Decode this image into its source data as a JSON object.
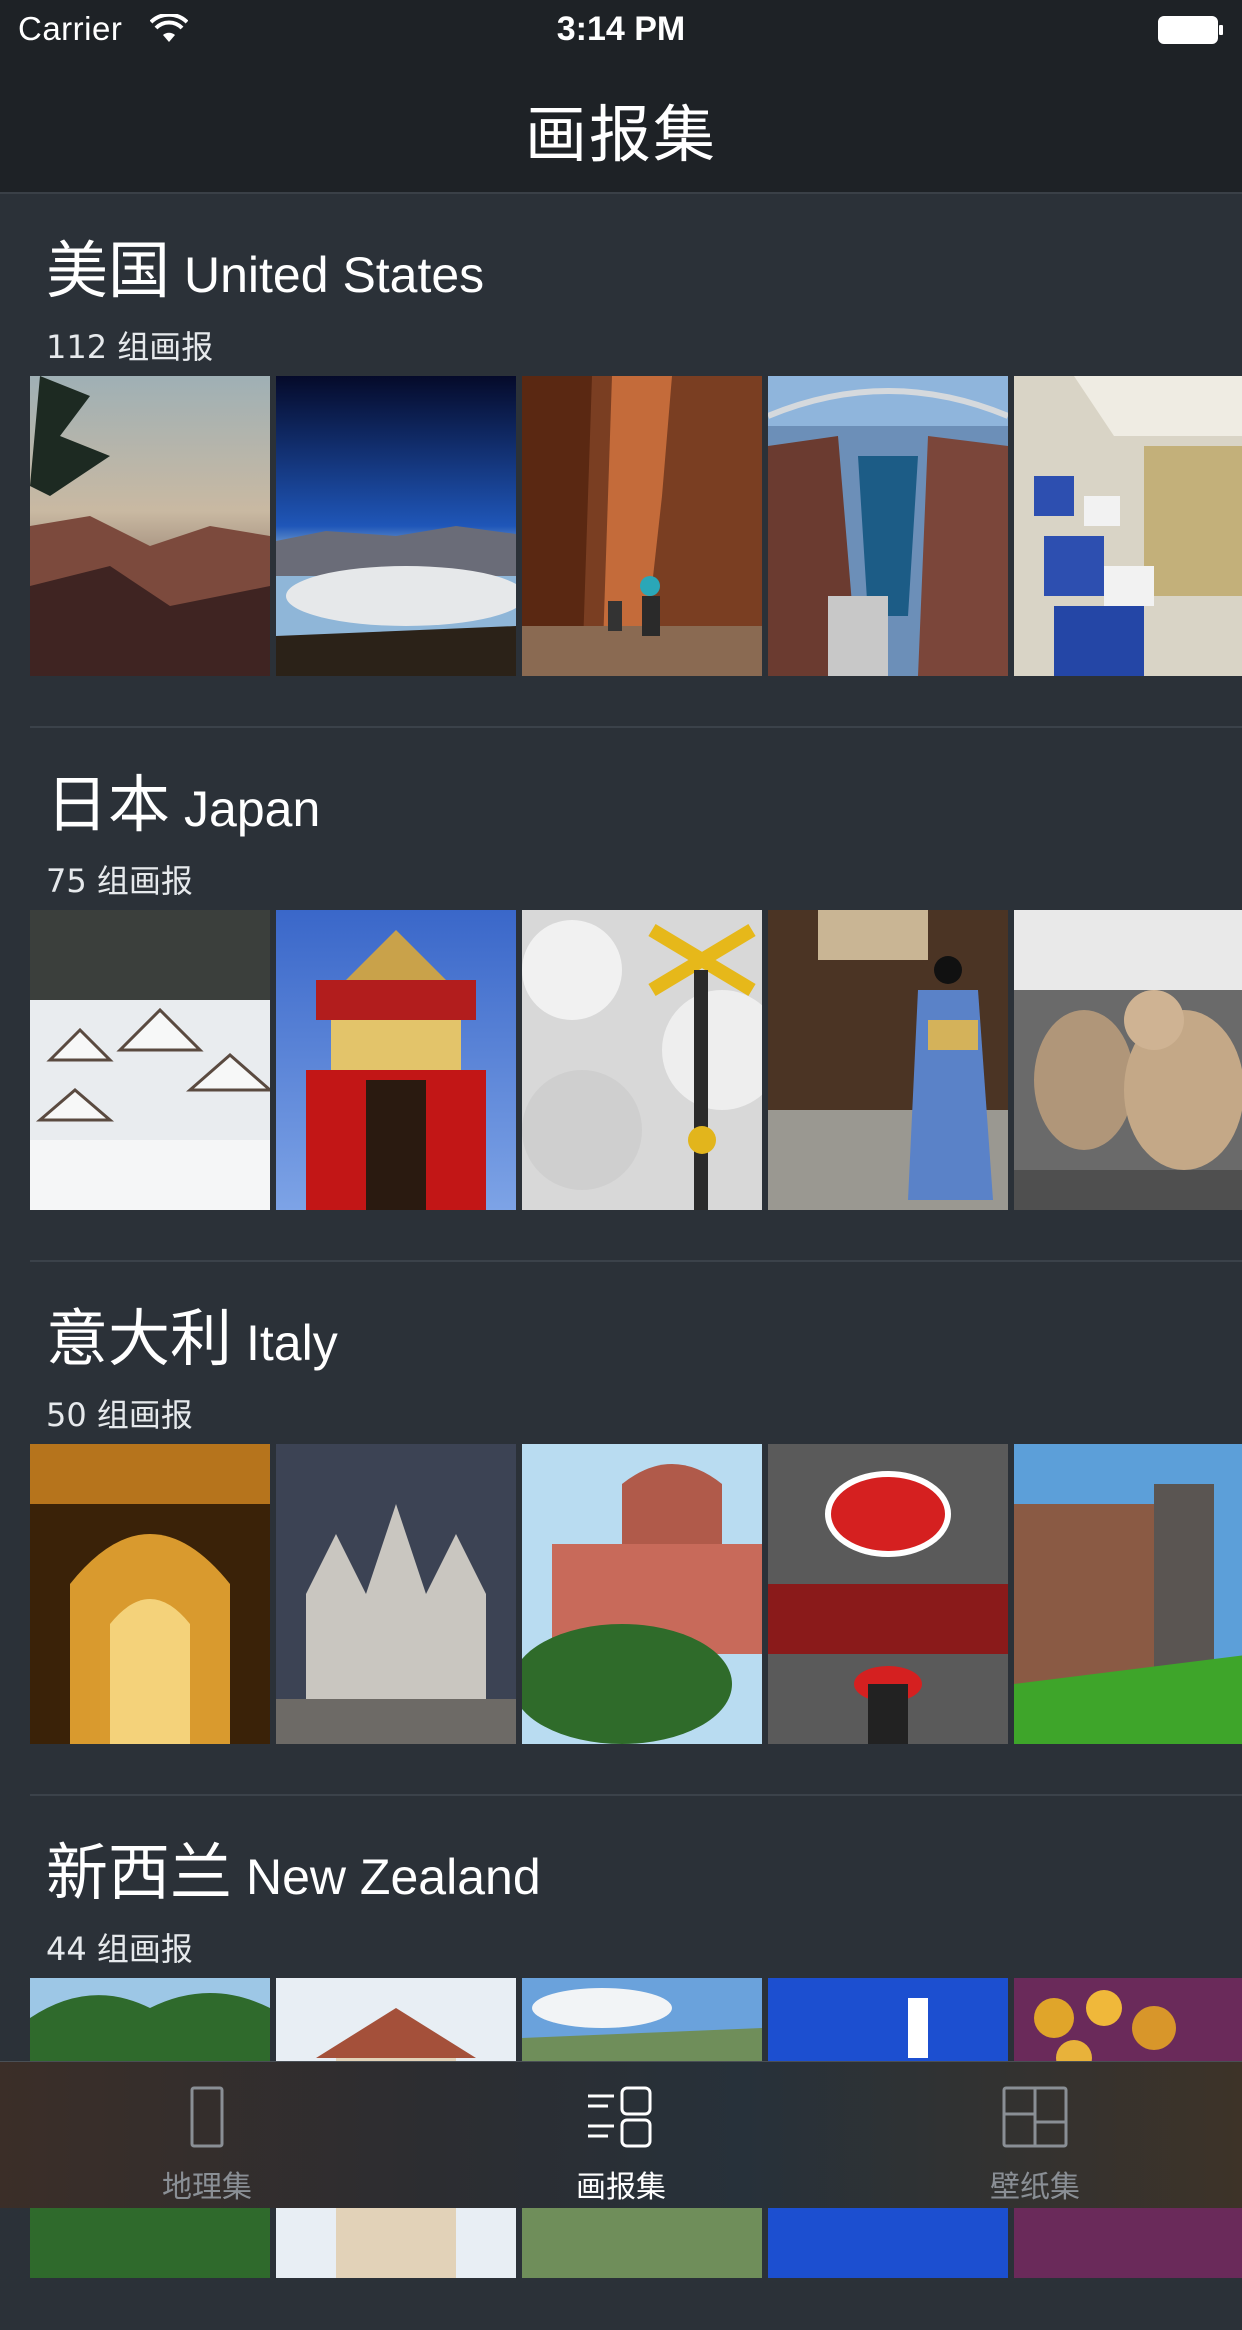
{
  "status_bar": {
    "carrier": "Carrier",
    "time": "3:14 PM"
  },
  "nav": {
    "title": "画报集"
  },
  "sections": [
    {
      "title_zh": "美国",
      "title_en": "United States",
      "count": "112 组画报",
      "photos": [
        "grand-canyon-photo",
        "death-valley-photo",
        "zion-narrows-photo",
        "hoover-dam-bridge-photo",
        "train-car-photo"
      ]
    },
    {
      "title_zh": "日本",
      "title_en": "Japan",
      "count": "75 组画报",
      "photos": [
        "snowy-village-photo",
        "festival-float-photo",
        "railroad-crossing-photo",
        "kimono-girl-photo",
        "snow-monkeys-photo"
      ]
    },
    {
      "title_zh": "意大利",
      "title_en": "Italy",
      "count": "50 组画报",
      "photos": [
        "galleria-photo",
        "milan-cathedral-photo",
        "church-dome-photo",
        "ac-milan-locker-photo",
        "sforza-castle-photo"
      ]
    },
    {
      "title_zh": "新西兰",
      "title_en": "New Zealand",
      "count": "44 组画报",
      "photos": [
        "forest-photo",
        "house-roof-photo",
        "coast-sky-photo",
        "blue-sky-tower-photo",
        "fruit-photo"
      ]
    }
  ],
  "tabbar": {
    "tabs": [
      {
        "label": "地理集",
        "icon": "geography-icon",
        "active": false
      },
      {
        "label": "画报集",
        "icon": "pictorial-list-icon",
        "active": true
      },
      {
        "label": "壁纸集",
        "icon": "wallpaper-grid-icon",
        "active": false
      }
    ]
  },
  "colors": {
    "background": "#2b3138",
    "nav": "#1e2226",
    "divider": "#3b424a",
    "tab_inactive": "#8a8f95"
  }
}
